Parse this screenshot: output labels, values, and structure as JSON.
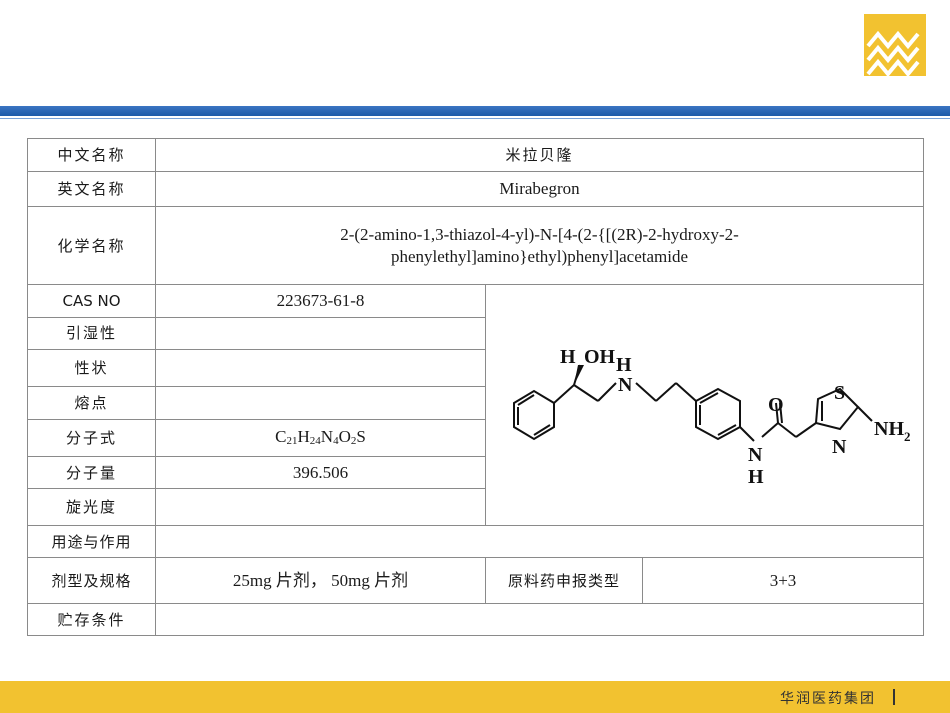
{
  "colors": {
    "brand_blue": "#1d5aa8",
    "brand_yellow": "#f2c230"
  },
  "logo": {
    "icon": "company-logo-icon"
  },
  "table": {
    "cn_name_label": "中文名称",
    "cn_name_value": "米拉贝隆",
    "en_name_label": "英文名称",
    "en_name_value": "Mirabegron",
    "chem_name_label": "化学名称",
    "chem_name_line1": "2-(2-amino-1,3-thiazol-4-yl)-N-[4-(2-{[(2R)-2-hydroxy-2-",
    "chem_name_line2": "phenylethyl]amino}ethyl)phenyl]acetamide",
    "cas_label": "CAS NO",
    "cas_value": "223673-61-8",
    "hygro_label": "引湿性",
    "hygro_value": "",
    "appearance_label": "性状",
    "appearance_value": "",
    "melting_label": "熔点",
    "melting_value": "",
    "formula_label": "分子式",
    "formula": {
      "c": "C",
      "c_n": "21",
      "h": "H",
      "h_n": "24",
      "n": "N",
      "n_n": "4",
      "o": "O",
      "o_n": "2",
      "s": "S"
    },
    "mw_label": "分子量",
    "mw_value": "396.506",
    "rotation_label": "旋光度",
    "rotation_value": "",
    "use_label": "用途与作用",
    "use_value": "",
    "dosage_label": "剂型及规格",
    "dosage_value": "25mg 片剂， 50mg 片剂",
    "api_type_label": "原料药申报类型",
    "api_type_value": "3+3",
    "storage_label": "贮存条件",
    "storage_value": ""
  },
  "structure": {
    "h_top": "H",
    "oh": "OH",
    "nh_h": "H",
    "nh_n": "N",
    "o": "O",
    "amide_n": "N",
    "amide_h": "H",
    "s": "S",
    "ring_n": "N",
    "nh2": "NH",
    "nh2_sub": "2"
  },
  "footer": {
    "company": "华润医药集团"
  }
}
